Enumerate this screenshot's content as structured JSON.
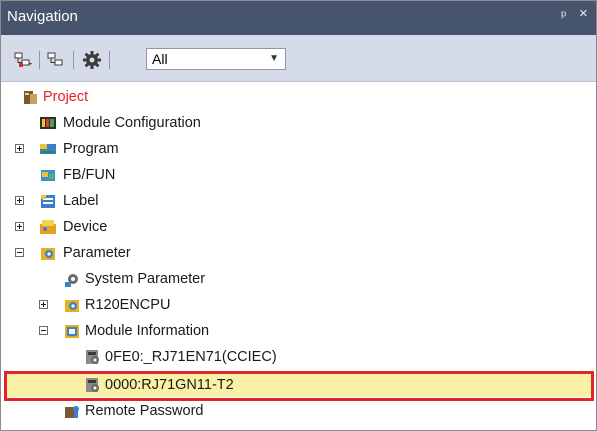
{
  "panel": {
    "title": "Navigation",
    "pin_glyph": "ᵖ",
    "close_glyph": "×"
  },
  "toolbar": {
    "buttons": [
      {
        "name": "expand-tree-icon"
      },
      {
        "name": "collapse-tree-icon"
      },
      {
        "name": "settings-gear-icon"
      }
    ],
    "filter": {
      "value": "All"
    }
  },
  "tree": [
    {
      "label": "Project",
      "icon": "project-icon",
      "color": "#e8202a"
    },
    {
      "label": "Module Configuration",
      "icon": "module-config-icon"
    },
    {
      "label": "Program",
      "icon": "program-icon",
      "expander": "plus"
    },
    {
      "label": "FB/FUN",
      "icon": "fb-fun-icon"
    },
    {
      "label": "Label",
      "icon": "label-icon",
      "expander": "plus"
    },
    {
      "label": "Device",
      "icon": "device-icon",
      "expander": "plus"
    },
    {
      "label": "Parameter",
      "icon": "parameter-icon",
      "expander": "minus"
    },
    {
      "label": "System Parameter",
      "icon": "system-parameter-icon"
    },
    {
      "label": "R120ENCPU",
      "icon": "cpu-parameter-icon",
      "expander": "plus"
    },
    {
      "label": "Module Information",
      "icon": "module-information-icon",
      "expander": "minus"
    },
    {
      "label": "0FE0:_RJ71EN71(CCIEC)",
      "icon": "module-icon"
    },
    {
      "label": "0000:RJ71GN11-T2",
      "icon": "module-icon",
      "selected": true
    },
    {
      "label": "Remote Password",
      "icon": "remote-password-icon"
    }
  ],
  "colors": {
    "title_bar": "#46546e",
    "toolbar_bg": "#d6dbe9",
    "selection": "#fbf1a6",
    "highlight_border": "#e0262e",
    "project_text": "#e8202a"
  }
}
